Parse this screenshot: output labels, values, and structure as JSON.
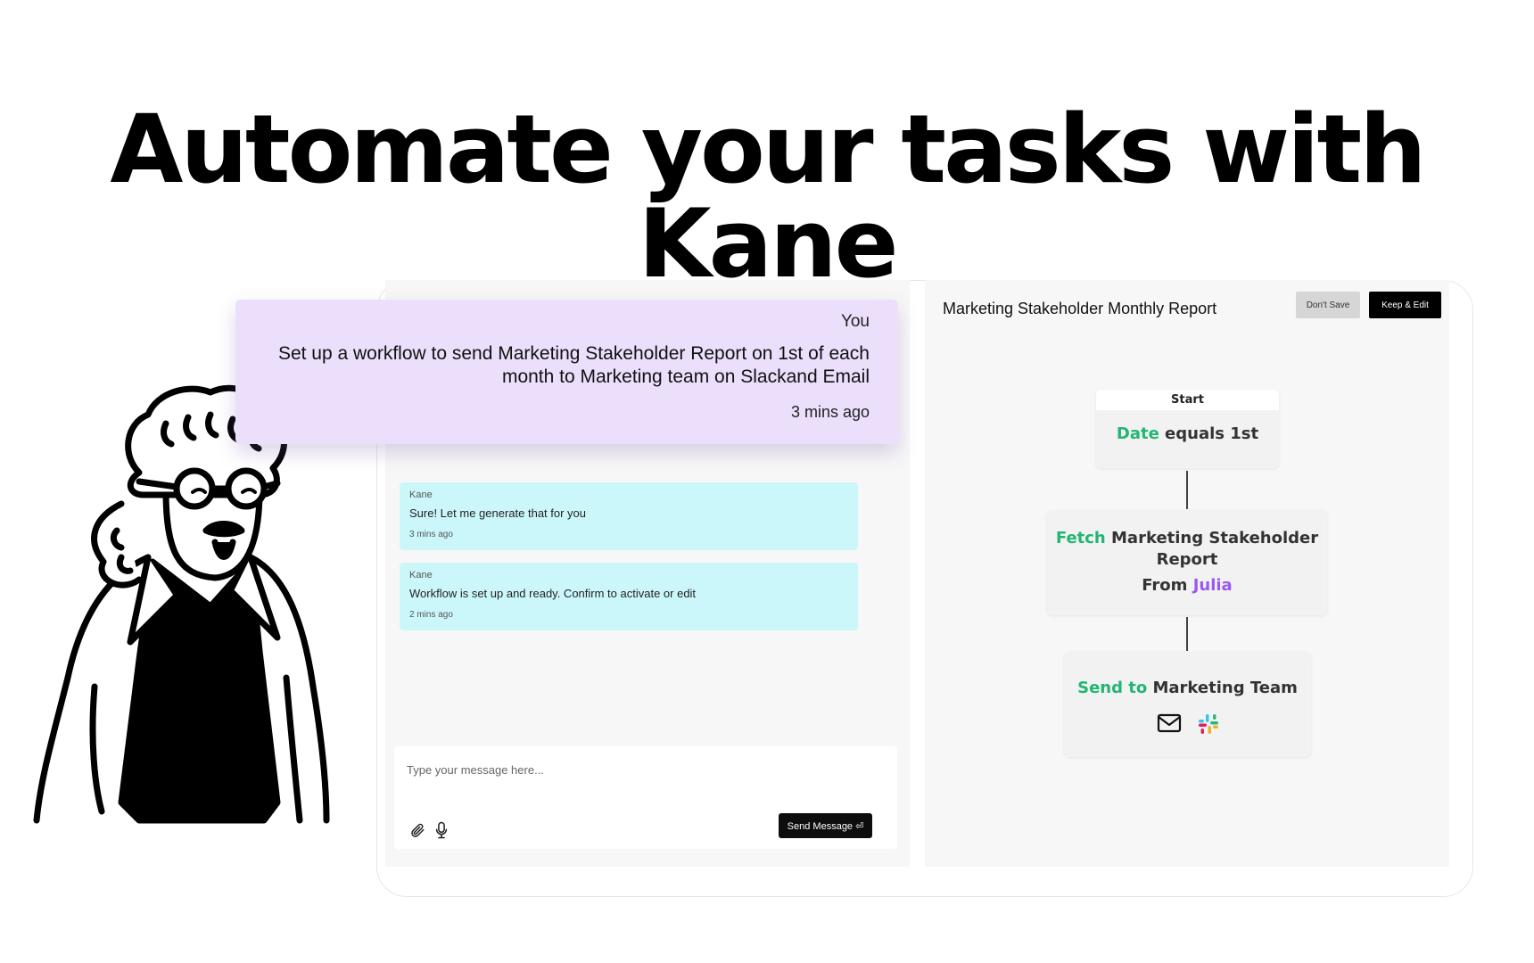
{
  "headline": "Automate your tasks with Kane",
  "chat": {
    "user_message": {
      "sender": "You",
      "text": "Set up a workflow to send Marketing Stakeholder Report on 1st of each month to Marketing team on Slackand Email",
      "time": "3 mins ago"
    },
    "kane_messages": [
      {
        "sender": "Kane",
        "text": "Sure! Let me generate that for you",
        "time": "3 mins ago"
      },
      {
        "sender": "Kane",
        "text": "Workflow is set up and ready. Confirm to activate or edit",
        "time": "2 mins ago"
      }
    ],
    "input": {
      "placeholder": "Type your message here...",
      "value": ""
    },
    "send_label": "Send Message ⏎"
  },
  "workflow": {
    "title": "Marketing Stakeholder Monthly Report",
    "dont_save_label": "Don't Save",
    "keep_edit_label": "Keep & Edit",
    "start": {
      "label": "Start",
      "keyword": "Date",
      "text": " equals 1st"
    },
    "fetch": {
      "keyword": "Fetch",
      "text": " Marketing Stakeholder Report",
      "from_label": "From ",
      "from_value": "Julia"
    },
    "send": {
      "keyword": "Send to",
      "text": " Marketing Team",
      "channels": [
        "mail-icon",
        "slack-icon"
      ]
    }
  },
  "colors": {
    "accent_green": "#22b573",
    "accent_purple": "#9b59f0",
    "user_bubble": "#ecdffc",
    "kane_bubble": "#cbf7fb"
  }
}
